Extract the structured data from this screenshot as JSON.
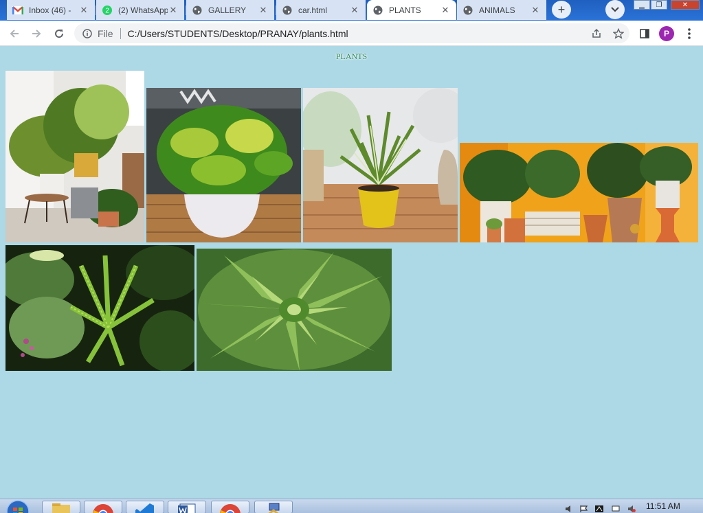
{
  "browser": {
    "tabs": [
      {
        "title": "Inbox (46) - ",
        "icon": "gmail-icon",
        "active": false
      },
      {
        "title": "(2) WhatsApp",
        "icon": "whatsapp-icon",
        "active": false
      },
      {
        "title": "GALLERY",
        "icon": "globe-icon",
        "active": false
      },
      {
        "title": "car.html",
        "icon": "globe-icon",
        "active": false
      },
      {
        "title": "PLANTS",
        "icon": "globe-icon",
        "active": true
      },
      {
        "title": "ANIMALS",
        "icon": "globe-icon",
        "active": false
      }
    ],
    "address": {
      "scheme_label": "File",
      "url": "C:/Users/STUDENTS/Desktop/PRANAY/plants.html"
    },
    "profile_initial": "P",
    "whatsapp_badge": "2"
  },
  "page": {
    "heading": "PLANTS",
    "background_color": "#add8e6",
    "heading_color": "#2e8b57",
    "images": [
      {
        "subject": "indoor plants on stands"
      },
      {
        "subject": "money plant in white pot"
      },
      {
        "subject": "spider plant in yellow pot"
      },
      {
        "subject": "potted plants on orange background"
      },
      {
        "subject": "fern garden"
      },
      {
        "subject": "spiral aloe succulent"
      }
    ]
  },
  "taskbar": {
    "clock": "11:51 AM"
  }
}
